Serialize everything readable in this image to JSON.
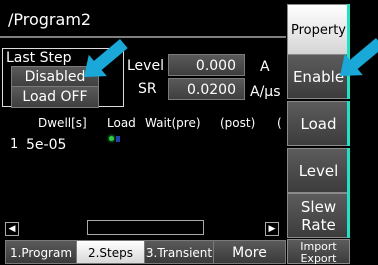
{
  "header": {
    "title": "/Program2"
  },
  "last_step": {
    "label": "Last Step",
    "state_value": "Disabled",
    "load_value": "Load OFF"
  },
  "params": {
    "level": {
      "label": "Level",
      "value": "0.000",
      "unit": "A"
    },
    "sr": {
      "label": "SR",
      "value": "0.0200",
      "unit": "A/µs"
    }
  },
  "table": {
    "columns": [
      "Dwell[s]",
      "Load",
      "Wait(pre)",
      "(post)",
      "("
    ],
    "rows": [
      {
        "index": "1",
        "dwell": "5e-05"
      }
    ]
  },
  "side_buttons": [
    "Property",
    "Enable",
    "Load",
    "Level",
    "Slew Rate",
    "Import Export"
  ],
  "tabs": [
    "1.Program",
    "2.Steps",
    "3.Transient",
    "More"
  ],
  "colors": {
    "accent": "#1fe2c2",
    "arrow": "#1aa8d8"
  }
}
